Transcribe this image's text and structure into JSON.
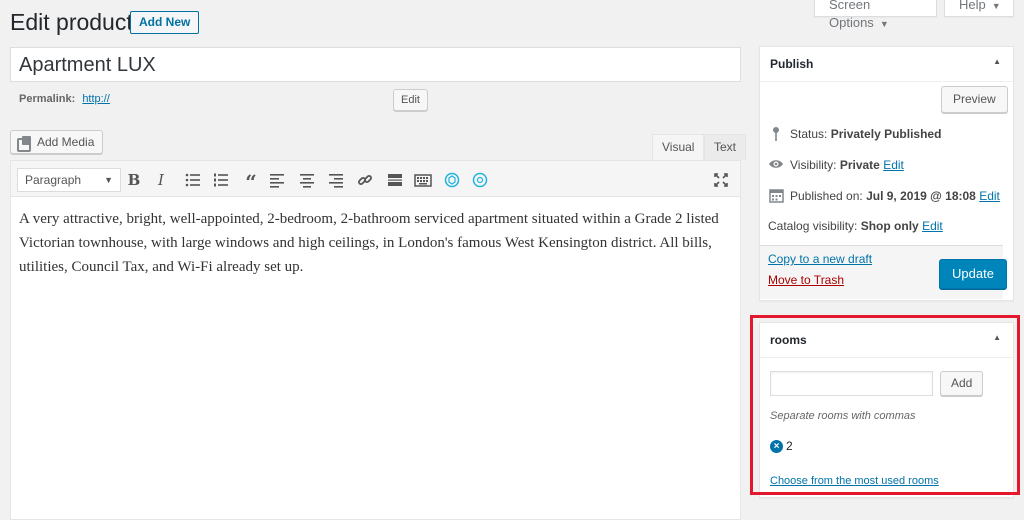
{
  "header": {
    "title": "Edit product",
    "add_new_label": "Add New",
    "screen_options_label": "Screen Options",
    "help_label": "Help"
  },
  "post": {
    "title": "Apartment LUX",
    "permalink_label": "Permalink:",
    "permalink_url": "http://",
    "edit_label": "Edit"
  },
  "editor": {
    "add_media_label": "Add Media",
    "tab_visual": "Visual",
    "tab_text": "Text",
    "format_value": "Paragraph",
    "content": "A very attractive, bright, well-appointed, 2-bedroom, 2-bathroom serviced apartment situated within a Grade 2 listed Victorian townhouse, with large windows and high ceilings, in London's famous West Kensington district. All bills, utilities, Council Tax, and Wi-Fi already set up."
  },
  "publish": {
    "title": "Publish",
    "preview_label": "Preview",
    "status_label": "Status:",
    "status_value": "Privately Published",
    "visibility_label": "Visibility:",
    "visibility_value": "Private",
    "visibility_edit": "Edit",
    "published_label": "Published on:",
    "published_value": "Jul 9, 2019 @ 18:08",
    "published_edit": "Edit",
    "catalog_label": "Catalog visibility:",
    "catalog_value": "Shop only",
    "catalog_edit": "Edit",
    "copy_draft_label": "Copy to a new draft",
    "trash_label": "Move to Trash",
    "update_label": "Update"
  },
  "rooms": {
    "title": "rooms",
    "input_value": "",
    "add_label": "Add",
    "hint": "Separate rooms with commas",
    "tags": [
      "2"
    ],
    "choose_link": "Choose from the most used rooms"
  },
  "colors": {
    "primary": "#0085ba",
    "link": "#0073aa",
    "highlight_border": "#e3182d",
    "trash": "#a00000"
  }
}
